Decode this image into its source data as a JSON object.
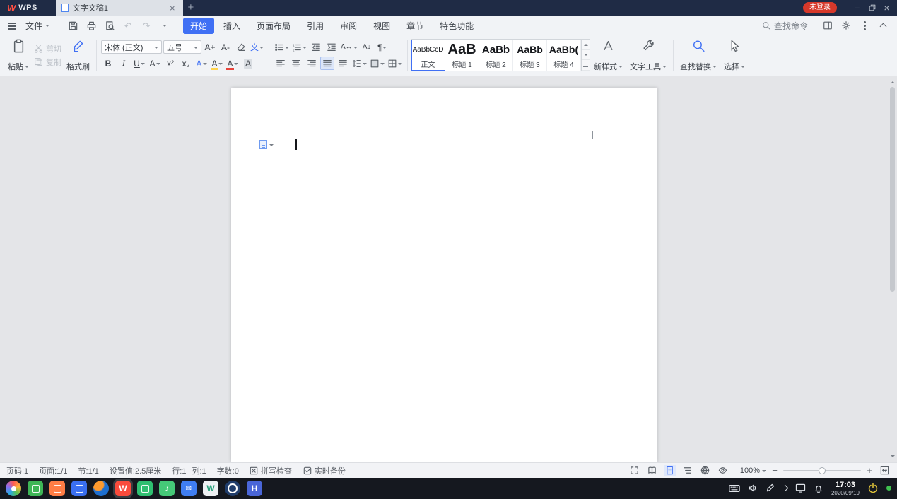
{
  "colors": {
    "accent": "#4070f4",
    "badge_red": "#d6382a"
  },
  "titlebar": {
    "logo": "WPS",
    "tab_title": "文字文稿1",
    "login_badge": "未登录"
  },
  "menubar": {
    "file_label": "文件",
    "tabs": [
      {
        "label": "开始",
        "active": true
      },
      {
        "label": "插入"
      },
      {
        "label": "页面布局"
      },
      {
        "label": "引用"
      },
      {
        "label": "审阅"
      },
      {
        "label": "视图"
      },
      {
        "label": "章节"
      },
      {
        "label": "特色功能"
      }
    ],
    "search_label": "查找命令"
  },
  "ribbon": {
    "paste_label": "粘贴",
    "cut_label": "剪切",
    "copy_label": "复制",
    "format_painter_label": "格式刷",
    "font_name": "宋体 (正文)",
    "font_size": "五号",
    "styles": [
      {
        "sample": "AaBbCcD",
        "label": "正文"
      },
      {
        "sample": "AaB",
        "label": "标题 1"
      },
      {
        "sample": "AaBb",
        "label": "标题 2"
      },
      {
        "sample": "AaBb",
        "label": "标题 3"
      },
      {
        "sample": "AaBb(",
        "label": "标题 4"
      }
    ],
    "new_style_label": "新样式",
    "text_tool_label": "文字工具",
    "find_replace_label": "查找替换",
    "select_label": "选择"
  },
  "icons": {
    "bold": "B",
    "italic": "I",
    "underline": "U",
    "strikethrough": "A",
    "superscript": "x²",
    "subscript": "x₂",
    "text_effect": "A",
    "highlight": "A",
    "font_color": "A",
    "char_shading": "A",
    "pinyin": "文",
    "inc_font": "A+",
    "dec_font": "A-",
    "text_scale": "A↔",
    "sort": "A↓",
    "show_marks": "¶",
    "undo": "↶",
    "redo": "↷"
  },
  "statusbar": {
    "items": [
      "页码:1",
      "页面:1/1",
      "节:1/1",
      "设置值:2.5厘米",
      "行:1",
      "列:1",
      "字数:0"
    ],
    "spell_check": "拼写检查",
    "backup": "实时备份",
    "zoom_level": "100%"
  },
  "taskbar": {
    "time": "17:03",
    "date": "2020/09/19",
    "apps": [
      {
        "name": "launcher",
        "color": "",
        "glyph": ""
      },
      {
        "name": "green-app",
        "color": "#3eb556",
        "glyph": ""
      },
      {
        "name": "app-store",
        "color": "#ff7d45",
        "glyph": ""
      },
      {
        "name": "file-manager",
        "color": "#3a6ff0",
        "glyph": ""
      },
      {
        "name": "browser",
        "color": "#1e6fd0",
        "glyph": ""
      },
      {
        "name": "wps-office",
        "color": "#fa4b3c",
        "glyph": "W"
      },
      {
        "name": "media-player",
        "color": "#2fbf71",
        "glyph": ""
      },
      {
        "name": "music",
        "color": "#45c878",
        "glyph": "♪"
      },
      {
        "name": "mail",
        "color": "#3f7ef2",
        "glyph": "✉"
      },
      {
        "name": "doc-viewer",
        "color": "#eef1f4",
        "glyph": "W"
      },
      {
        "name": "control-center",
        "color": "#203d6b",
        "glyph": ""
      },
      {
        "name": "h-app",
        "color": "#4a66d8",
        "glyph": "H"
      }
    ]
  }
}
